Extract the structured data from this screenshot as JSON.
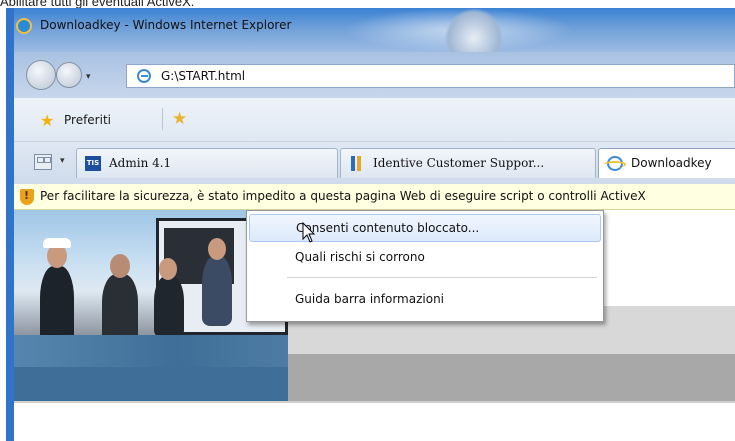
{
  "doc": {
    "top_text": "Abilitare tutti gli eventuali ActiveX."
  },
  "window": {
    "title": "Downloadkey - Windows Internet Explorer"
  },
  "address": {
    "url": "G:\\START.html"
  },
  "favorites": {
    "label": "Preferiti"
  },
  "tabs": [
    {
      "label": "Admin 4.1",
      "icon": "tis-icon"
    },
    {
      "label": "Identive Customer Suppor...",
      "icon": "identive-icon"
    },
    {
      "label": "Downloadkey",
      "icon": "ie-icon",
      "active": true
    }
  ],
  "info_bar": {
    "text": "Per facilitare la sicurezza, è stato impedito a questa pagina Web di eseguire script o controlli ActiveX"
  },
  "context_menu": {
    "items": [
      {
        "label": "Consenti contenuto bloccato...",
        "highlighted": true
      },
      {
        "label": "Quali rischi si corrono"
      },
      {
        "label": "Guida barra informazioni"
      }
    ]
  },
  "colors": {
    "frame": "#2f74c9",
    "info_bar": "#ffffe1",
    "menu_highlight": "#dceafc"
  }
}
